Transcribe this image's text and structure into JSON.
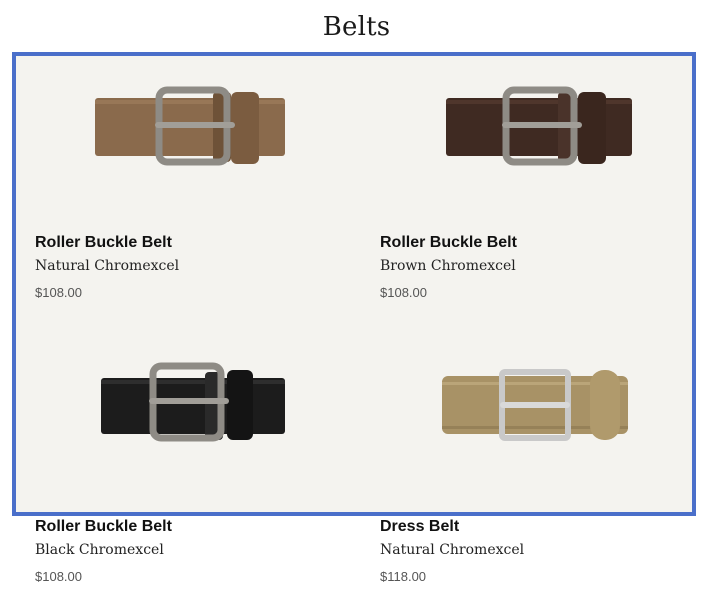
{
  "page": {
    "title": "Belts"
  },
  "colors": {
    "highlight_border": "#4a6fca",
    "card_background": "#f4f3ef"
  },
  "products": [
    {
      "name": "Roller Buckle Belt",
      "variant": "Natural Chromexcel",
      "price": "$108.00",
      "icon": "belt-image-natural",
      "leather_color": "#8a6a4c",
      "buckle": "roller"
    },
    {
      "name": "Roller Buckle Belt",
      "variant": "Brown Chromexcel",
      "price": "$108.00",
      "icon": "belt-image-brown",
      "leather_color": "#3f2a22",
      "buckle": "roller"
    },
    {
      "name": "Roller Buckle Belt",
      "variant": "Black Chromexcel",
      "price": "$108.00",
      "icon": "belt-image-black",
      "leather_color": "#1c1c1c",
      "buckle": "roller"
    },
    {
      "name": "Dress Belt",
      "variant": "Natural Chromexcel",
      "price": "$118.00",
      "icon": "belt-image-natural-dress",
      "leather_color": "#a89266",
      "buckle": "dress"
    }
  ]
}
